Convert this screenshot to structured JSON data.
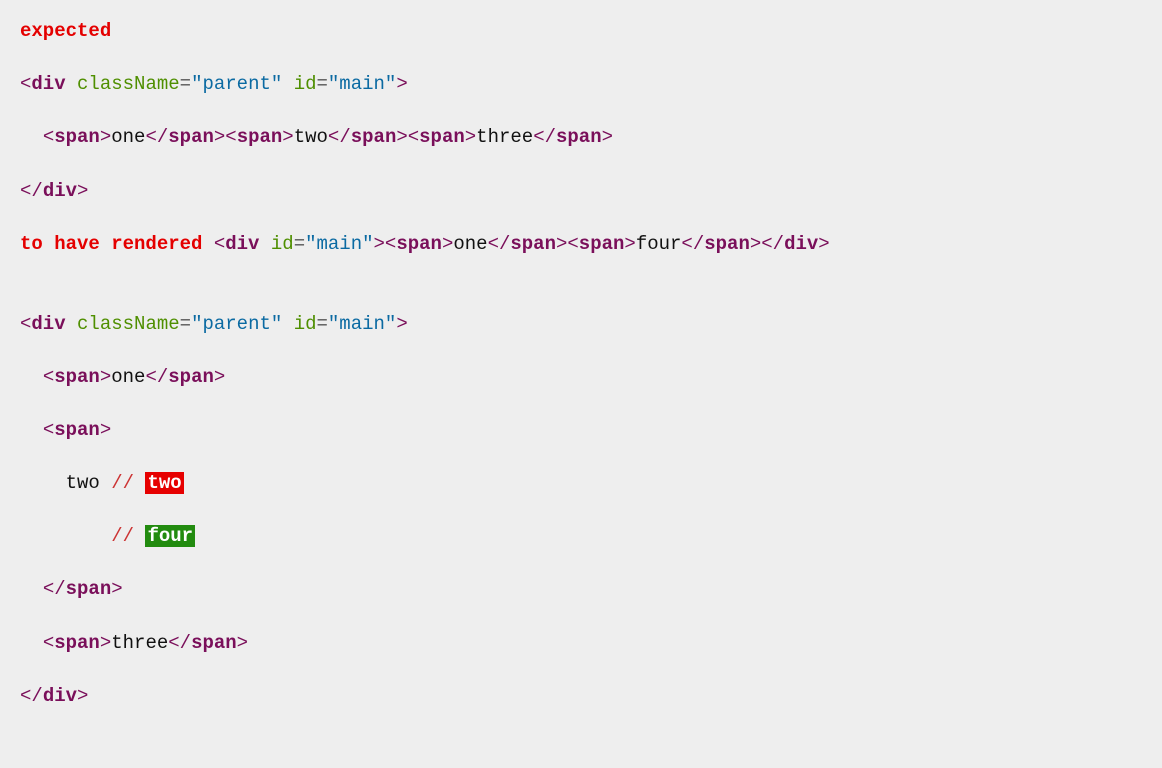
{
  "assertion": {
    "expected_kw": "expected",
    "to_have_rendered_kw": "to have rendered"
  },
  "tags": {
    "div": "div",
    "span": "span"
  },
  "attrs": {
    "className": "className",
    "id": "id"
  },
  "values": {
    "parent": "\"parent\"",
    "main": "\"main\""
  },
  "text": {
    "one": "one",
    "two": "two",
    "three": "three",
    "four": "four"
  },
  "diff": {
    "sep": "//",
    "old": "two",
    "new": "four"
  },
  "punct": {
    "lt": "<",
    "gt": ">",
    "lts": "</",
    "eq": "="
  }
}
